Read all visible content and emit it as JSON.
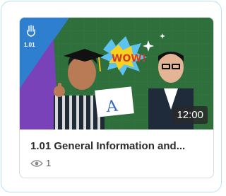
{
  "card": {
    "lesson_code": "1.01",
    "duration": "12:00",
    "title": "1.01 General Information and...",
    "views": "1",
    "thumbnail_bubble_text": "WOW!",
    "board_mark": "A"
  },
  "icons": {
    "badge": "hand-pointer-icon",
    "views": "eye-icon"
  },
  "colors": {
    "frame_border": "#bcdff0",
    "chalkboard": "#2f6f3c",
    "badge_blue": "#2f7fd0",
    "badge_purple": "#7e3fbf"
  }
}
